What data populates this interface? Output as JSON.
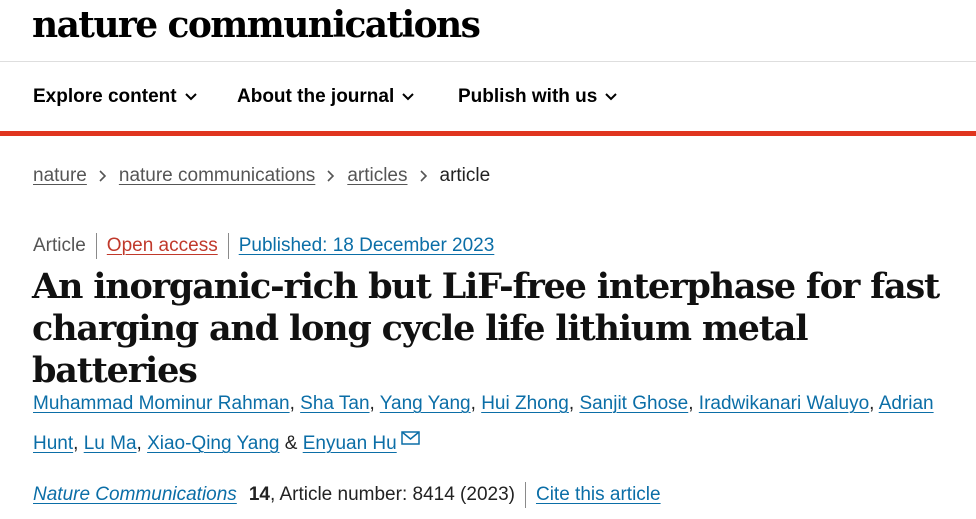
{
  "header": {
    "logo": "nature communications"
  },
  "nav": {
    "items": [
      {
        "label": "Explore content",
        "icon": "chevron-down-icon"
      },
      {
        "label": "About the journal",
        "icon": "chevron-down-icon"
      },
      {
        "label": "Publish with us",
        "icon": "chevron-down-icon"
      }
    ]
  },
  "breadcrumb": {
    "items": [
      "nature",
      "nature communications",
      "articles",
      "article"
    ],
    "separator_icon": "chevron-right-icon"
  },
  "article": {
    "type": "Article",
    "access": "Open access",
    "published": "Published: 18 December 2023",
    "title": "An inorganic-rich but LiF-free interphase for fast charging and long cycle life lithium metal batteries",
    "authors": [
      "Muhammad Mominur Rahman",
      "Sha Tan",
      "Yang Yang",
      "Hui Zhong",
      "Sanjit Ghose",
      "Iradwikanari Waluyo",
      "Adrian Hunt",
      "Lu Ma",
      "Xiao-Qing Yang",
      "Enyuan Hu"
    ],
    "author_separator": ", ",
    "author_last_separator": " & ",
    "corresponding_icon": "mail-icon",
    "journal": "Nature Communications",
    "volume": "14",
    "article_number": ", Article number: 8414 (2023)",
    "cite_label": "Cite this article"
  },
  "colors": {
    "accent_bar": "#e0351f",
    "link": "#0b6ea7",
    "open_access": "#c0392b"
  }
}
